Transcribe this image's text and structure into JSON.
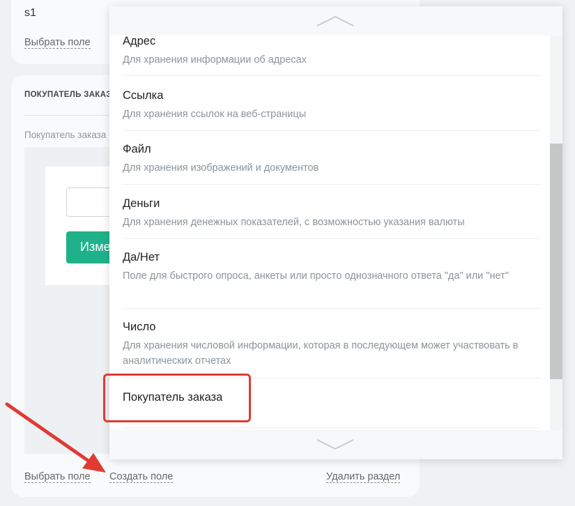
{
  "background_panel": {
    "top_value": "s1",
    "top_choose_field": "Выбрать поле",
    "section_title": "ПОКУПАТЕЛЬ ЗАКАЗА",
    "section_subtitle": "Покупатель заказа",
    "preview_button_label": "Изменить",
    "bottom_links": {
      "choose_field": "Выбрать поле",
      "create_field": "Создать поле",
      "delete_section": "Удалить раздел"
    }
  },
  "field_type_menu": {
    "items": [
      {
        "title": "Адрес",
        "description": "Для хранения информации об адресах"
      },
      {
        "title": "Ссылка",
        "description": "Для хранения ссылок на веб-страницы"
      },
      {
        "title": "Файл",
        "description": "Для хранения изображений и документов"
      },
      {
        "title": "Деньги",
        "description": "Для хранения денежных показателей, с возможностью указания валюты"
      },
      {
        "title": "Да/Нет",
        "description": "Поле для быстрого опроса, анкеты или просто однозначного ответа \"да\" или \"нет\""
      },
      {
        "title": "Число",
        "description": "Для хранения числовой информации, которая в последующем может участвовать в аналитических отчетах"
      },
      {
        "title": "Покупатель заказа",
        "description": ""
      }
    ],
    "highlighted_item": "Покупатель заказа",
    "scroll_up_icon": "chevron-up-icon",
    "scroll_down_icon": "chevron-down-icon"
  },
  "annotation": {
    "arrow_color": "#e03a33",
    "highlight_color": "#e03a33"
  },
  "colors": {
    "accent_green": "#1fb28a",
    "page_background": "#eef2f4"
  }
}
